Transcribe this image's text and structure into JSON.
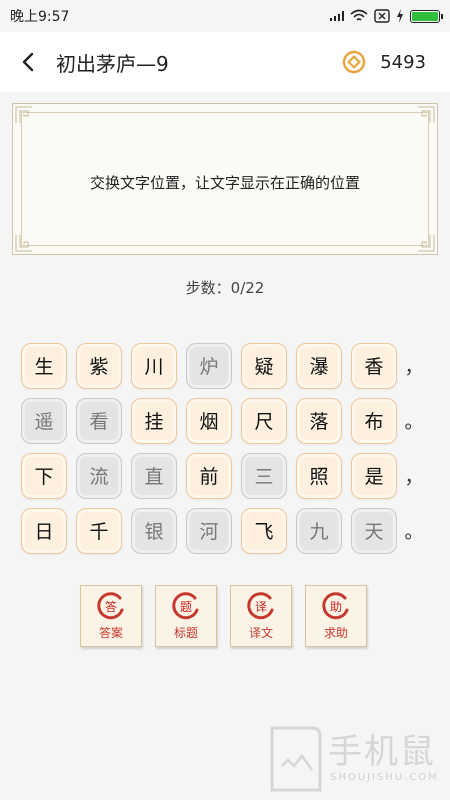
{
  "status": {
    "time": "晚上9:57"
  },
  "header": {
    "title": "初出茅庐—9",
    "coins": "5493"
  },
  "instruction": "交换文字位置，让文字显示在正确的位置",
  "steps": "步数：0/22",
  "grid": [
    {
      "tiles": [
        {
          "char": "生",
          "state": "active"
        },
        {
          "char": "紫",
          "state": "active"
        },
        {
          "char": "川",
          "state": "active"
        },
        {
          "char": "炉",
          "state": "done"
        },
        {
          "char": "疑",
          "state": "active"
        },
        {
          "char": "瀑",
          "state": "active"
        },
        {
          "char": "香",
          "state": "active"
        }
      ],
      "punct": "，"
    },
    {
      "tiles": [
        {
          "char": "遥",
          "state": "done"
        },
        {
          "char": "看",
          "state": "done"
        },
        {
          "char": "挂",
          "state": "active"
        },
        {
          "char": "烟",
          "state": "active"
        },
        {
          "char": "尺",
          "state": "active"
        },
        {
          "char": "落",
          "state": "active"
        },
        {
          "char": "布",
          "state": "active"
        }
      ],
      "punct": "。"
    },
    {
      "tiles": [
        {
          "char": "下",
          "state": "active"
        },
        {
          "char": "流",
          "state": "done"
        },
        {
          "char": "直",
          "state": "done"
        },
        {
          "char": "前",
          "state": "active"
        },
        {
          "char": "三",
          "state": "done"
        },
        {
          "char": "照",
          "state": "active"
        },
        {
          "char": "是",
          "state": "active"
        }
      ],
      "punct": "，"
    },
    {
      "tiles": [
        {
          "char": "日",
          "state": "active"
        },
        {
          "char": "千",
          "state": "active"
        },
        {
          "char": "银",
          "state": "done"
        },
        {
          "char": "河",
          "state": "done"
        },
        {
          "char": "飞",
          "state": "active"
        },
        {
          "char": "九",
          "state": "done"
        },
        {
          "char": "天",
          "state": "done"
        }
      ],
      "punct": "。"
    }
  ],
  "actions": [
    {
      "seal": "答",
      "label": "答案"
    },
    {
      "seal": "题",
      "label": "标题"
    },
    {
      "seal": "译",
      "label": "译文"
    },
    {
      "seal": "助",
      "label": "求助"
    }
  ],
  "watermark": {
    "title": "手机鼠",
    "subtitle": "SHOUJISHU.COM"
  },
  "colors": {
    "accent_orange": "#f0c79a",
    "seal_red": "#c4382e",
    "coin_gold": "#e8a33a"
  },
  "icons": {
    "back": "chevron-left-icon",
    "coin": "coin-icon"
  }
}
